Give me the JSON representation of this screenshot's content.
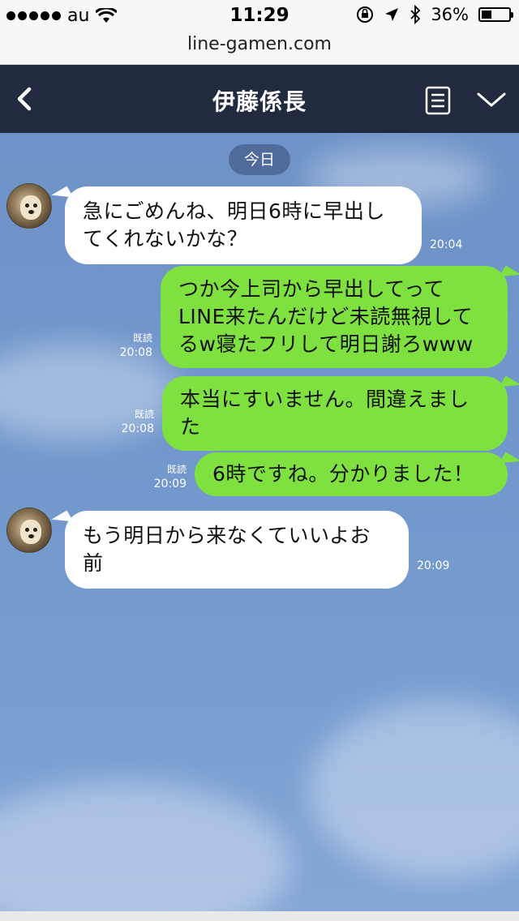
{
  "status": {
    "carrier": "au",
    "time": "11:29",
    "battery": "36%",
    "battery_level": 0.36
  },
  "browser": {
    "url": "line-gamen.com"
  },
  "header": {
    "title": "伊藤係長"
  },
  "chat": {
    "date_label": "今日",
    "messages": [
      {
        "side": "in",
        "lines": [
          "急にごめんね、明日6時に早出し",
          "てくれないかな？"
        ],
        "time": "20:04"
      },
      {
        "side": "out",
        "lines": [
          "つか今上司から早出してって",
          "LINE来たんだけど未読無視して",
          "るw寝たフリして明日謝ろwww"
        ],
        "read": "既読",
        "time": "20:08"
      },
      {
        "side": "out",
        "lines": [
          "本当にすいません。間違えまし",
          "た"
        ],
        "read": "既読",
        "time": "20:08"
      },
      {
        "side": "out",
        "lines": [
          "6時ですね。分かりました！"
        ],
        "read": "既読",
        "time": "20:09"
      },
      {
        "side": "in",
        "lines": [
          "もう明日から来なくていいよお",
          "前"
        ],
        "time": "20:09"
      }
    ]
  },
  "colors": {
    "header_bg": "#222a40",
    "chat_bg": "#7197cc",
    "incoming_bubble": "#ffffff",
    "outgoing_bubble": "#7fe140"
  },
  "icons": {
    "back": "chevron-left-icon",
    "menu": "notes-icon",
    "more": "chevron-down-icon"
  }
}
